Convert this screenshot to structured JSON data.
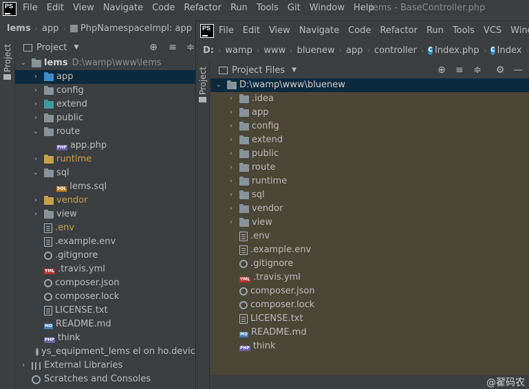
{
  "app": {
    "logo_text": "PS",
    "window_title": "lems - BaseController.php",
    "menu": [
      "File",
      "Edit",
      "View",
      "Navigate",
      "Code",
      "Refactor",
      "Run",
      "Tools",
      "Git",
      "Window",
      "Help"
    ]
  },
  "back": {
    "breadcrumb": [
      "lems",
      "app",
      "PhpNamespaceImpl: app"
    ],
    "tool_window_label": "Project",
    "project_label": "Project",
    "side_tab": "Project",
    "root": {
      "name": "lems",
      "path": "D:\\wamp\\www\\lems"
    },
    "tree": [
      {
        "label": "app",
        "kind": "folder",
        "color": "blue",
        "arrow": "›",
        "depth": 1,
        "highlight": true
      },
      {
        "label": "config",
        "kind": "folder",
        "color": "gray",
        "arrow": "›",
        "depth": 1
      },
      {
        "label": "extend",
        "kind": "folder",
        "color": "teal",
        "arrow": "›",
        "depth": 1
      },
      {
        "label": "public",
        "kind": "folder",
        "color": "gray",
        "arrow": "›",
        "depth": 1
      },
      {
        "label": "route",
        "kind": "folder",
        "color": "gray",
        "arrow": "⌄",
        "depth": 1
      },
      {
        "label": "app.php",
        "kind": "php",
        "depth": 2
      },
      {
        "label": "runtime",
        "kind": "folder",
        "color": "orange",
        "arrow": "›",
        "depth": 1,
        "text_color": "#c7a04a"
      },
      {
        "label": "sql",
        "kind": "folder",
        "color": "gray",
        "arrow": "⌄",
        "depth": 1
      },
      {
        "label": "lems.sql",
        "kind": "sql",
        "depth": 2
      },
      {
        "label": "vendor",
        "kind": "folder",
        "color": "orange",
        "arrow": "›",
        "depth": 1,
        "text_color": "#c7a04a"
      },
      {
        "label": "view",
        "kind": "folder",
        "color": "gray",
        "arrow": "›",
        "depth": 1
      },
      {
        "label": ".env",
        "kind": "file",
        "depth": 1,
        "text_color": "#c7a04a"
      },
      {
        "label": ".example.env",
        "kind": "file",
        "depth": 1
      },
      {
        "label": ".gitignore",
        "kind": "gear",
        "depth": 1
      },
      {
        "label": ".travis.yml",
        "kind": "yml",
        "depth": 1
      },
      {
        "label": "composer.json",
        "kind": "gear",
        "depth": 1
      },
      {
        "label": "composer.lock",
        "kind": "gear",
        "depth": 1
      },
      {
        "label": "LICENSE.txt",
        "kind": "file",
        "depth": 1
      },
      {
        "label": "README.md",
        "kind": "md",
        "depth": 1
      },
      {
        "label": "think",
        "kind": "php",
        "depth": 1
      },
      {
        "label": "ys_equipment_lems el on ho.device",
        "kind": "gear",
        "depth": 1
      }
    ],
    "external_libraries": "External Libraries",
    "scratches": "Scratches and Consoles"
  },
  "front": {
    "menu": [
      "File",
      "Edit",
      "View",
      "Navigate",
      "Code",
      "Refactor",
      "Run",
      "Tools",
      "VCS",
      "Window"
    ],
    "breadcrumb": [
      "D:",
      "wamp",
      "www",
      "bluenew",
      "app",
      "controller",
      "Index.php",
      "Index"
    ],
    "side_tab": "Project",
    "project_files_label": "Project Files",
    "root_path": "D:\\wamp\\www\\bluenew",
    "tree": [
      {
        "label": ".idea",
        "kind": "folder",
        "arrow": "›"
      },
      {
        "label": "app",
        "kind": "folder",
        "arrow": "›"
      },
      {
        "label": "config",
        "kind": "folder",
        "arrow": "›"
      },
      {
        "label": "extend",
        "kind": "folder",
        "arrow": "›"
      },
      {
        "label": "public",
        "kind": "folder",
        "arrow": "›"
      },
      {
        "label": "route",
        "kind": "folder",
        "arrow": "›"
      },
      {
        "label": "runtime",
        "kind": "folder",
        "arrow": "›"
      },
      {
        "label": "sql",
        "kind": "folder",
        "arrow": "›"
      },
      {
        "label": "vendor",
        "kind": "folder",
        "arrow": "›"
      },
      {
        "label": "view",
        "kind": "folder",
        "arrow": "›"
      },
      {
        "label": ".env",
        "kind": "file"
      },
      {
        "label": ".example.env",
        "kind": "file"
      },
      {
        "label": ".gitignore",
        "kind": "gear"
      },
      {
        "label": ".travis.yml",
        "kind": "yml"
      },
      {
        "label": "composer.json",
        "kind": "gear"
      },
      {
        "label": "composer.lock",
        "kind": "gear"
      },
      {
        "label": "LICENSE.txt",
        "kind": "file"
      },
      {
        "label": "README.md",
        "kind": "md"
      },
      {
        "label": "think",
        "kind": "php"
      }
    ]
  },
  "watermark": "@翟码农",
  "colors": {
    "ide_bg": "#3c3f41",
    "selected_bg": "#0d293e",
    "front_tree_bg": "#4c4637",
    "accent_orange": "#c7a04a"
  }
}
